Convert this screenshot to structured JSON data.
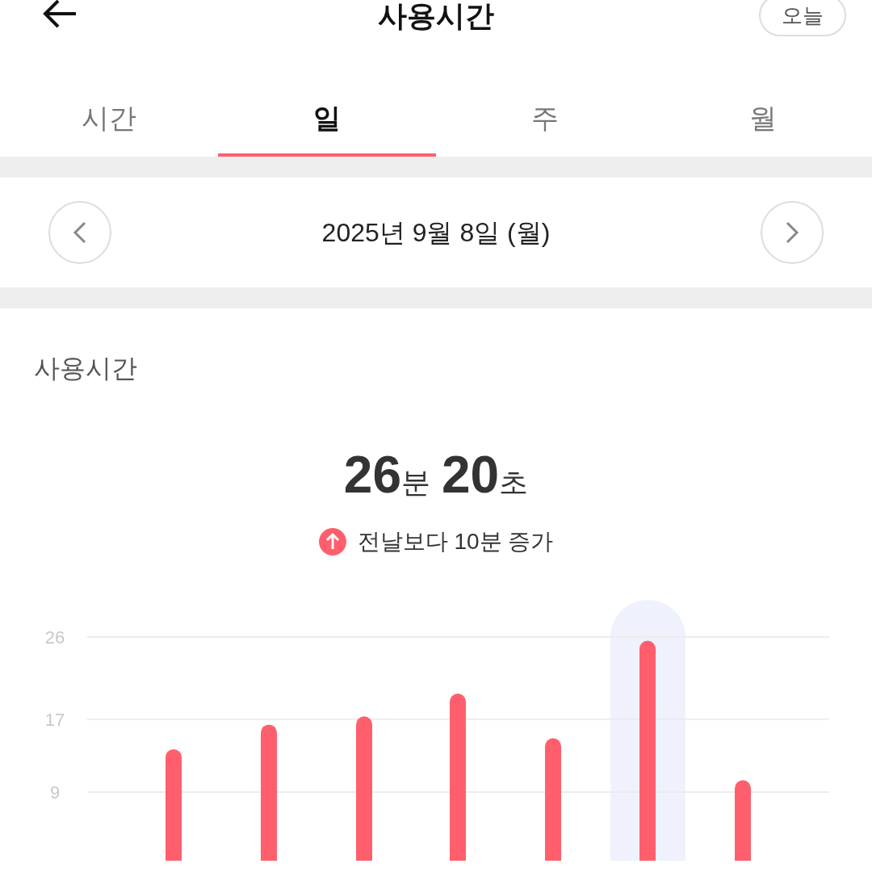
{
  "header": {
    "title": "사용시간",
    "today_button": "오늘"
  },
  "tabs": [
    {
      "label": "시간",
      "selected": false
    },
    {
      "label": "일",
      "selected": true
    },
    {
      "label": "주",
      "selected": false
    },
    {
      "label": "월",
      "selected": false
    }
  ],
  "date_nav": {
    "date": "2025년 9월 8일 (월)"
  },
  "summary": {
    "heading": "사용시간",
    "minutes": "26",
    "minutes_unit": "분",
    "seconds": "20",
    "seconds_unit": "초",
    "change": "전날보다 10분 증가"
  },
  "chart": {
    "chart_data": {
      "type": "bar",
      "ylim": [
        0,
        26
      ],
      "yticks": [
        26,
        17,
        9
      ],
      "series": [
        {
          "color": "#ff5f6d",
          "values": [
            13.7,
            16.4,
            17.3,
            19.8,
            14.9,
            25.6,
            10.3
          ]
        }
      ]
    }
  }
}
